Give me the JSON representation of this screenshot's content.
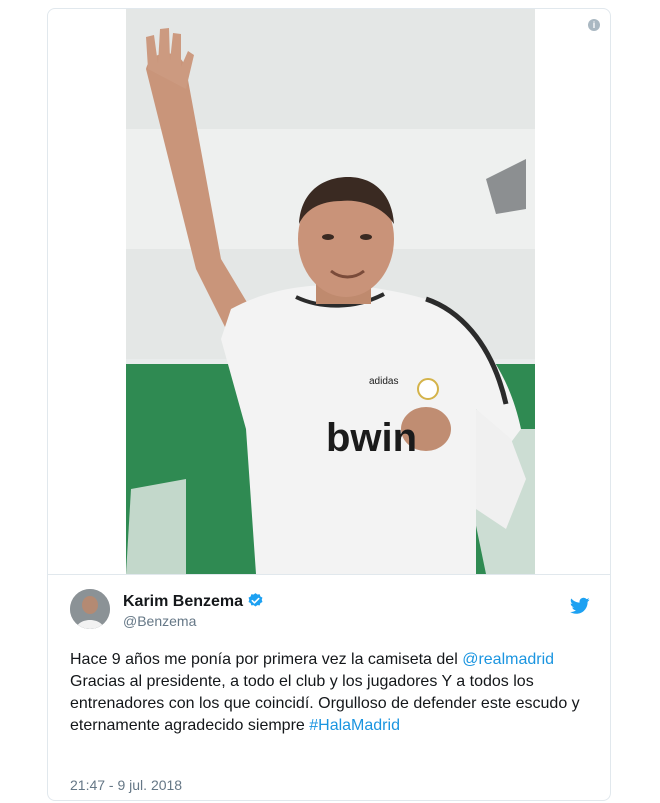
{
  "tweet": {
    "author_name": "Karim Benzema",
    "author_handle": "@Benzema",
    "text_1": "Hace 9 años me ponía por primera vez la camiseta del ",
    "mention": "@realmadrid",
    "text_2": " Gracias al presidente, a todo el club y los jugadores Y a todos los entrenadores con los que coincidí. Orgulloso de defender este escudo y eternamente agradecido siempre ",
    "hashtag": "#HalaMadrid",
    "timestamp": "21:47 - 9 jul. 2018"
  },
  "media": {
    "jersey_sponsor": "bwin",
    "jersey_brand": "adidas"
  },
  "icons": {
    "info": "info-icon",
    "verified": "verified-badge-icon",
    "platform": "twitter-bird-icon"
  },
  "colors": {
    "link": "#1b95e0",
    "verified": "#1da1f2",
    "text": "#14171a",
    "secondary": "#657786"
  }
}
